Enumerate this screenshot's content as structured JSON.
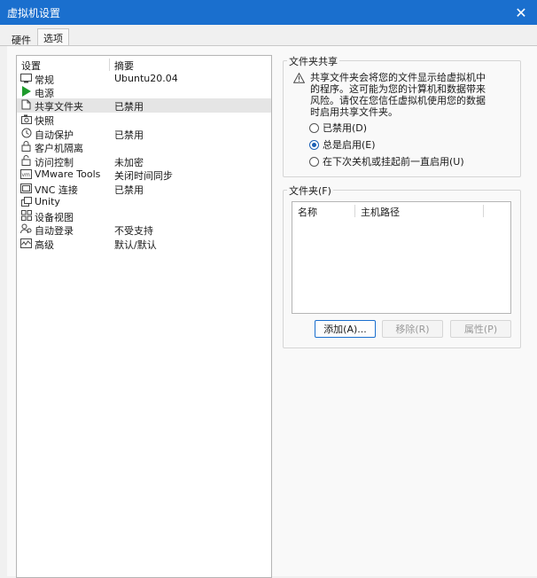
{
  "window": {
    "title": "虚拟机设置"
  },
  "tabs": [
    {
      "label": "硬件",
      "active": false
    },
    {
      "label": "选项",
      "active": true
    }
  ],
  "settings_list": {
    "col_setting": "设置",
    "col_summary": "摘要",
    "items": [
      {
        "name": "常规",
        "summary": "Ubuntu20.04",
        "icon": "general-icon"
      },
      {
        "name": "电源",
        "summary": "",
        "icon": "power-icon"
      },
      {
        "name": "共享文件夹",
        "summary": "已禁用",
        "icon": "shared-folder-icon",
        "selected": true
      },
      {
        "name": "快照",
        "summary": "",
        "icon": "snapshot-icon"
      },
      {
        "name": "自动保护",
        "summary": "已禁用",
        "icon": "autoprotect-icon"
      },
      {
        "name": "客户机隔离",
        "summary": "",
        "icon": "isolation-icon"
      },
      {
        "name": "访问控制",
        "summary": "未加密",
        "icon": "access-control-icon"
      },
      {
        "name": "VMware Tools",
        "summary": "关闭时间同步",
        "icon": "vmware-tools-icon"
      },
      {
        "name": "VNC 连接",
        "summary": "已禁用",
        "icon": "vnc-icon"
      },
      {
        "name": "Unity",
        "summary": "",
        "icon": "unity-icon"
      },
      {
        "name": "设备视图",
        "summary": "",
        "icon": "device-view-icon"
      },
      {
        "name": "自动登录",
        "summary": "不受支持",
        "icon": "autologin-icon"
      },
      {
        "name": "高级",
        "summary": "默认/默认",
        "icon": "advanced-icon"
      }
    ]
  },
  "sharing": {
    "title": "文件夹共享",
    "warning": "共享文件夹会将您的文件显示给虚拟机中的程序。这可能为您的计算机和数据带来风险。请仅在您信任虚拟机使用您的数据时启用共享文件夹。",
    "options": [
      {
        "label": "已禁用(D)",
        "checked": false
      },
      {
        "label": "总是启用(E)",
        "checked": true
      },
      {
        "label": "在下次关机或挂起前一直启用(U)",
        "checked": false
      }
    ]
  },
  "folders": {
    "title": "文件夹(F)",
    "col_name": "名称",
    "col_path": "主机路径",
    "add_label": "添加(A)...",
    "remove_label": "移除(R)",
    "props_label": "属性(P)"
  },
  "colors": {
    "titlebar": "#1a6fce",
    "accent": "#1a5fb4",
    "power": "#1e9b2c"
  }
}
